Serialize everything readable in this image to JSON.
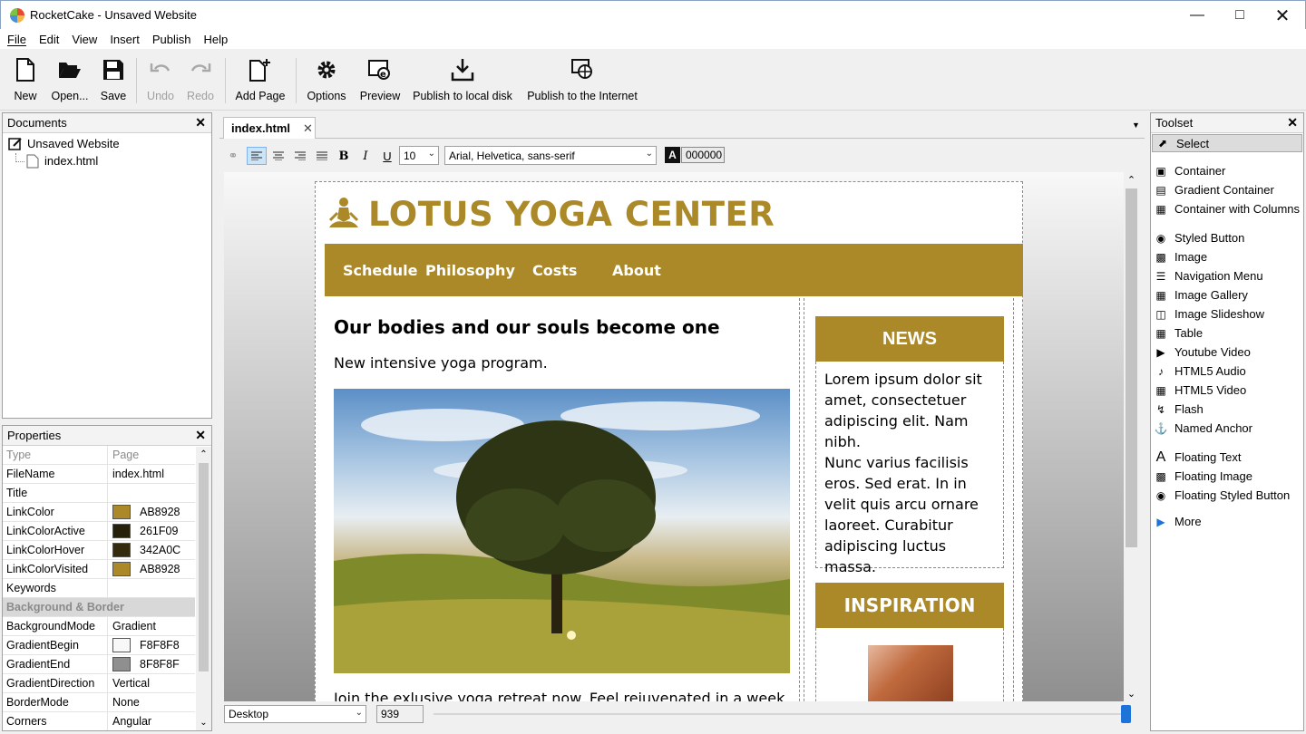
{
  "window": {
    "title": "RocketCake - Unsaved Website"
  },
  "menu": [
    "File",
    "Edit",
    "View",
    "Insert",
    "Publish",
    "Help"
  ],
  "toolbar": {
    "new": "New",
    "open": "Open...",
    "save": "Save",
    "undo": "Undo",
    "redo": "Redo",
    "add_page": "Add Page",
    "options": "Options",
    "preview": "Preview",
    "publish_local": "Publish to local disk",
    "publish_internet": "Publish to the Internet"
  },
  "documents": {
    "header": "Documents",
    "root": "Unsaved Website",
    "pages": [
      "index.html"
    ]
  },
  "properties": {
    "header": "Properties",
    "col_type": "Type",
    "col_page": "Page",
    "rows": [
      {
        "key": "FileName",
        "value": "index.html"
      },
      {
        "key": "Title",
        "value": ""
      },
      {
        "key": "LinkColor",
        "value": "AB8928",
        "color": "#AB8928"
      },
      {
        "key": "LinkColorActive",
        "value": "261F09",
        "color": "#261F09"
      },
      {
        "key": "LinkColorHover",
        "value": "342A0C",
        "color": "#342A0C"
      },
      {
        "key": "LinkColorVisited",
        "value": "AB8928",
        "color": "#AB8928"
      },
      {
        "key": "Keywords",
        "value": ""
      },
      {
        "section": "Background & Border"
      },
      {
        "key": "BackgroundMode",
        "value": "Gradient"
      },
      {
        "key": "GradientBegin",
        "value": "F8F8F8",
        "color": "#F8F8F8"
      },
      {
        "key": "GradientEnd",
        "value": "8F8F8F",
        "color": "#8F8F8F"
      },
      {
        "key": "GradientDirection",
        "value": "Vertical"
      },
      {
        "key": "BorderMode",
        "value": "None"
      },
      {
        "key": "Corners",
        "value": "Angular"
      }
    ]
  },
  "editor": {
    "tab": "index.html",
    "font_size": "10",
    "font_family": "Arial, Helvetica, sans-serif",
    "text_color": "000000",
    "view_mode": "Desktop",
    "width_value": "939"
  },
  "site": {
    "brand": "LOTUS YOGA CENTER",
    "accent": "#AB8928",
    "nav": [
      "Schedule",
      "Philosophy",
      "Costs",
      "About"
    ],
    "heading": "Our bodies and our souls become one",
    "subheading": "New intensive yoga program.",
    "body_text": "Join the exlusive yoga retreat now. Feel rejuvenated in a week.",
    "news_title": "NEWS",
    "news_text_1": "Lorem ipsum dolor sit amet, consectetuer adipiscing elit. Nam nibh.",
    "news_text_2": "Nunc varius facilisis eros. Sed erat. In in velit quis arcu ornare laoreet. Curabitur adipiscing luctus massa.",
    "inspiration_title": "INSPIRATION"
  },
  "toolset": {
    "header": "Toolset",
    "select": "Select",
    "groups": [
      [
        {
          "label": "Container",
          "icon": "container-icon"
        },
        {
          "label": "Gradient Container",
          "icon": "gradient-container-icon"
        },
        {
          "label": "Container with Columns",
          "icon": "columns-icon"
        }
      ],
      [
        {
          "label": "Styled Button",
          "icon": "button-icon"
        },
        {
          "label": "Image",
          "icon": "image-icon"
        },
        {
          "label": "Navigation Menu",
          "icon": "menu-icon"
        },
        {
          "label": "Image Gallery",
          "icon": "gallery-icon"
        },
        {
          "label": "Image Slideshow",
          "icon": "slideshow-icon"
        },
        {
          "label": "Table",
          "icon": "table-icon"
        },
        {
          "label": "Youtube Video",
          "icon": "youtube-icon"
        },
        {
          "label": "HTML5 Audio",
          "icon": "audio-icon"
        },
        {
          "label": "HTML5 Video",
          "icon": "video-icon"
        },
        {
          "label": "Flash",
          "icon": "flash-icon"
        },
        {
          "label": "Named Anchor",
          "icon": "anchor-icon"
        }
      ],
      [
        {
          "label": "Floating Text",
          "icon": "text-icon"
        },
        {
          "label": "Floating Image",
          "icon": "floating-image-icon"
        },
        {
          "label": "Floating Styled Button",
          "icon": "floating-button-icon"
        }
      ]
    ],
    "more": "More"
  }
}
